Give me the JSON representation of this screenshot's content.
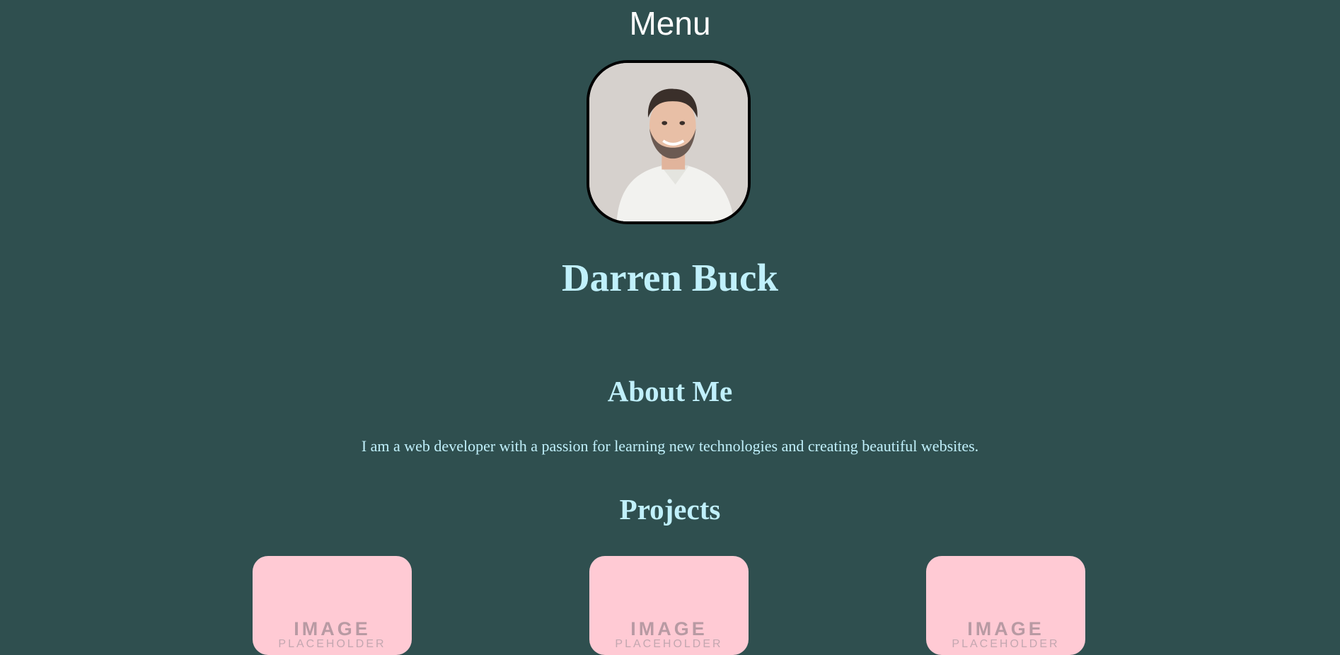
{
  "header": {
    "menu_label": "Menu"
  },
  "profile": {
    "photo_alt": "Darren Buck",
    "name": "Darren Buck"
  },
  "about": {
    "heading": "About Me",
    "text": "I am a web developer with a passion for learning new technologies and creating beautiful websites."
  },
  "projects": {
    "heading": "Projects",
    "items": [
      {
        "placeholder_title": "IMAGE",
        "placeholder_sub": "PLACEHOLDER"
      },
      {
        "placeholder_title": "IMAGE",
        "placeholder_sub": "PLACEHOLDER"
      },
      {
        "placeholder_title": "IMAGE",
        "placeholder_sub": "PLACEHOLDER"
      }
    ]
  },
  "colors": {
    "background": "#2f4f4f",
    "heading_text": "#c0f0fb",
    "menu_text": "#ffffff",
    "card_background": "#ffcad4"
  }
}
